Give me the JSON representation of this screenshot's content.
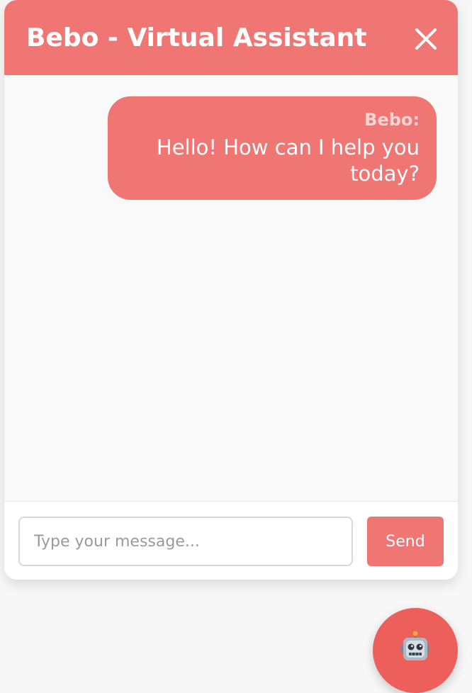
{
  "header": {
    "title": "Bebo - Virtual Assistant",
    "close_icon": "close-icon"
  },
  "messages": [
    {
      "sender": "Bebo:",
      "text": "Hello! How can I help you today?"
    }
  ],
  "composer": {
    "placeholder": "Type your message...",
    "value": "",
    "send_label": "Send"
  },
  "launcher": {
    "icon": "robot-icon"
  },
  "colors": {
    "accent": "#ef7672",
    "launcher": "#ec5f5a",
    "background": "#f9f9f9"
  }
}
